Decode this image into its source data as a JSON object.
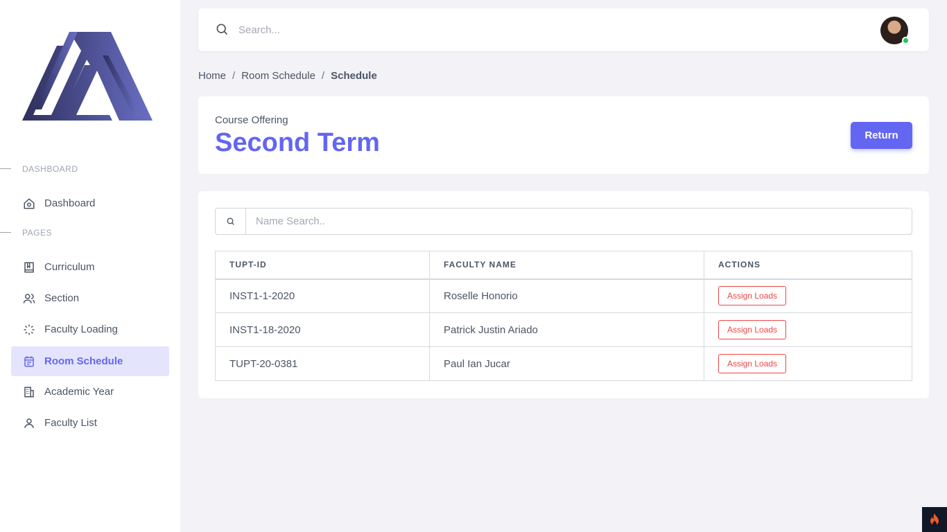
{
  "sidebar": {
    "sections": {
      "dashboard": "DASHBOARD",
      "pages": "PAGES"
    },
    "items": [
      {
        "label": "Dashboard",
        "icon": "home-icon"
      },
      {
        "label": "Curriculum",
        "icon": "book-icon"
      },
      {
        "label": "Section",
        "icon": "users-icon"
      },
      {
        "label": "Faculty Loading",
        "icon": "loader-icon"
      },
      {
        "label": "Room Schedule",
        "icon": "calendar-icon",
        "active": true
      },
      {
        "label": "Academic Year",
        "icon": "building-icon"
      },
      {
        "label": "Faculty List",
        "icon": "user-icon"
      }
    ]
  },
  "topbar": {
    "search_placeholder": "Search..."
  },
  "breadcrumb": {
    "home": "Home",
    "parent": "Room Schedule",
    "current": "Schedule"
  },
  "header": {
    "subtitle": "Course Offering",
    "title": "Second Term",
    "return_label": "Return"
  },
  "table": {
    "search_placeholder": "Name Search..",
    "columns": [
      "TUPT-ID",
      "FACULTY NAME",
      "ACTIONS"
    ],
    "rows": [
      {
        "id": "INST1-1-2020",
        "name": "Roselle Honorio",
        "action": "Assign Loads"
      },
      {
        "id": "INST1-18-2020",
        "name": "Patrick Justin Ariado",
        "action": "Assign Loads"
      },
      {
        "id": "TUPT-20-0381",
        "name": "Paul Ian Jucar",
        "action": "Assign Loads"
      }
    ]
  },
  "colors": {
    "accent": "#6366f1",
    "active_bg": "#e5e4fd",
    "danger": "#ef4444",
    "online": "#22c55e"
  }
}
